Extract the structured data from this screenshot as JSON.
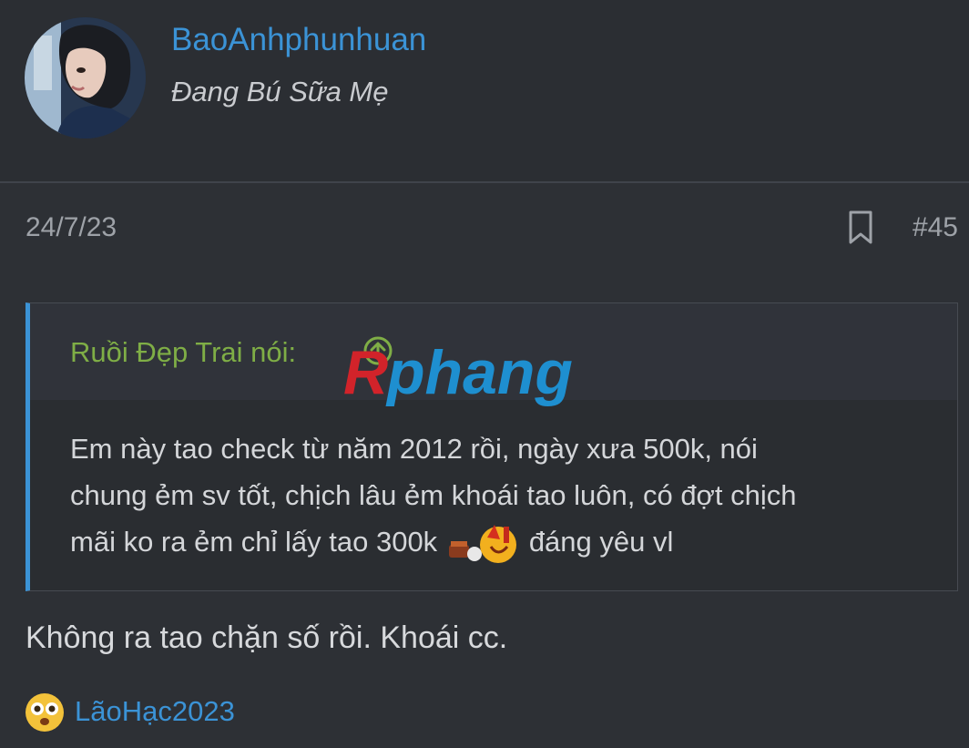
{
  "user": {
    "name": "BaoAnhphunhuan",
    "title": "Đang Bú Sữa Mẹ"
  },
  "post": {
    "date": "24/7/23",
    "number": "#45"
  },
  "quote": {
    "author": "Ruồi Đẹp Trai nói:",
    "line_1": "Em này tao check từ năm 2012 rồi, ngày xưa 500k, nói",
    "line_2": "chung ẻm sv tốt, chịch lâu ẻm khoái tao luôn, có đợt chịch",
    "line_3_before": "mãi ko ra ẻm chỉ lấy tao 300k",
    "line_3_after": "đáng yêu vl"
  },
  "watermark": "Rphang",
  "reply_text": "Không ra tao chặn số rồi. Khoái cc.",
  "reactions": {
    "emoji": "flushed-emoji-icon",
    "user": "LãoHạc2023"
  },
  "colors": {
    "background": "#2d3035",
    "link": "#3b93d6",
    "quote_author": "#7fae46",
    "quote_border": "#3b93d6"
  }
}
